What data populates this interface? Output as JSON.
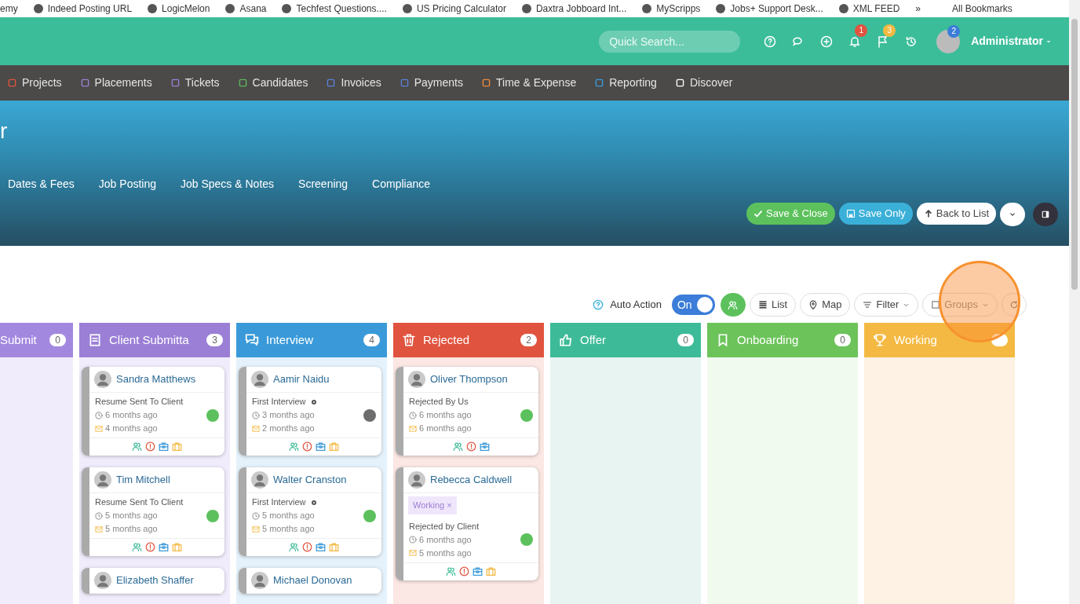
{
  "bookmarks": [
    {
      "label": "emy"
    },
    {
      "label": "Indeed Posting URL"
    },
    {
      "label": "LogicMelon"
    },
    {
      "label": "Asana"
    },
    {
      "label": "Techfest Questions...."
    },
    {
      "label": "US Pricing Calculator"
    },
    {
      "label": "Daxtra Jobboard Int..."
    },
    {
      "label": "MyScripps"
    },
    {
      "label": "Jobs+ Support Desk..."
    },
    {
      "label": "XML FEED"
    }
  ],
  "bookmarks_more": "»",
  "all_bookmarks": "All Bookmarks",
  "header": {
    "search": {
      "placeholder": "Quick Search..."
    },
    "notifications": "1",
    "flags": "3",
    "user_badge": "2",
    "user": "Administrator"
  },
  "nav": [
    {
      "label": "Projects",
      "color": "#e0533e"
    },
    {
      "label": "Placements",
      "color": "#9b7fd6"
    },
    {
      "label": "Tickets",
      "color": "#9b7fd6"
    },
    {
      "label": "Candidates",
      "color": "#5cb85c"
    },
    {
      "label": "Invoices",
      "color": "#5b7fd6"
    },
    {
      "label": "Payments",
      "color": "#5b7fd6"
    },
    {
      "label": "Time & Expense",
      "color": "#f08a3c"
    },
    {
      "label": "Reporting",
      "color": "#3a9ad9"
    },
    {
      "label": "Discover",
      "color": "#ffffff"
    }
  ],
  "hero": {
    "title": "r",
    "tabs": [
      "Dates & Fees",
      "Job Posting",
      "Job Specs & Notes",
      "Screening",
      "Compliance"
    ],
    "buttons": {
      "save_close": "Save & Close",
      "save_only": "Save Only",
      "back": "Back to List"
    }
  },
  "toolbar": {
    "auto_action": "Auto Action",
    "toggle": {
      "label": "On",
      "on": true
    },
    "list": "List",
    "map": "Map",
    "filter": "Filter",
    "groups": "Groups"
  },
  "columns": [
    {
      "title": "Submit",
      "count": "0",
      "kind": "submit"
    },
    {
      "title": "Client Submitta",
      "count": "3",
      "kind": "client",
      "cards": [
        {
          "name": "Sandra Matthews",
          "status": "Resume Sent To Client",
          "marker": false,
          "created": "6 months ago",
          "emailed": "4 months ago",
          "color": "#5cc15c",
          "suitcase": true
        },
        {
          "name": "Tim Mitchell",
          "status": "Resume Sent To Client",
          "marker": false,
          "created": "5 months ago",
          "emailed": "5 months ago",
          "color": "#5cc15c",
          "suitcase": true
        },
        {
          "name": "Elizabeth Shaffer"
        }
      ]
    },
    {
      "title": "Interview",
      "count": "4",
      "kind": "interview",
      "cards": [
        {
          "name": "Aamir Naidu",
          "status": "First Interview",
          "marker": true,
          "created": "3 months ago",
          "emailed": "2 months ago",
          "color": "#6d6d6d",
          "suitcase": true
        },
        {
          "name": "Walter Cranston",
          "status": "First Interview",
          "marker": true,
          "created": "5 months ago",
          "emailed": "5 months ago",
          "color": "#5cc15c",
          "suitcase": true
        },
        {
          "name": "Michael Donovan"
        }
      ]
    },
    {
      "title": "Rejected",
      "count": "2",
      "kind": "rejected",
      "cards": [
        {
          "name": "Oliver Thompson",
          "status": "Rejected By Us",
          "marker": false,
          "created": "6 months ago",
          "emailed": "6 months ago",
          "color": "#5cc15c",
          "suitcase": false
        },
        {
          "name": "Rebecca Caldwell",
          "tag": "Working",
          "tag_remove": "×",
          "status": "Rejected by Client",
          "marker": false,
          "created": "6 months ago",
          "emailed": "5 months ago",
          "color": "#5cc15c",
          "suitcase": true
        }
      ]
    },
    {
      "title": "Offer",
      "count": "0",
      "kind": "offer"
    },
    {
      "title": "Onboarding",
      "count": "0",
      "kind": "onboarding"
    },
    {
      "title": "Working",
      "kind": "working"
    }
  ]
}
